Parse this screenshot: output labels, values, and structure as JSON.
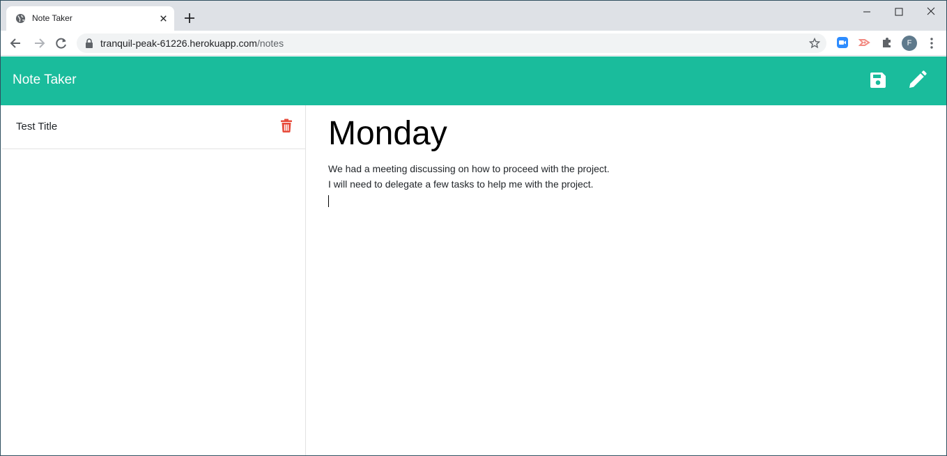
{
  "browser": {
    "tab_title": "Note Taker",
    "url_host": "tranquil-peak-61226.herokuapp.com",
    "url_path": "/notes",
    "profile_initial": "F"
  },
  "app": {
    "brand": "Note Taker",
    "accent_color": "#1abc9c",
    "delete_color": "#e74c3c"
  },
  "sidebar": {
    "notes": [
      {
        "title": "Test Title"
      }
    ]
  },
  "editor": {
    "title": "Monday",
    "body_lines": [
      "We had a meeting discussing on how to proceed with the project.",
      "I will need to delegate a few tasks to help me with the project."
    ]
  }
}
